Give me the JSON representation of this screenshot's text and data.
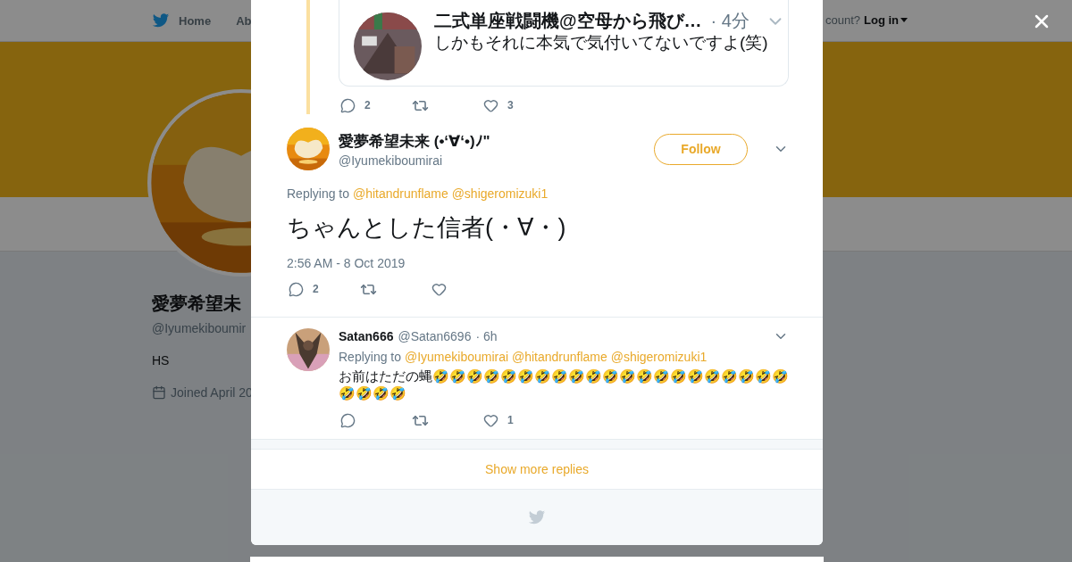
{
  "nav": {
    "home": "Home",
    "about": "Ab",
    "account_prompt": "count?",
    "login": "Log in"
  },
  "profile": {
    "name": "愛夢希望未",
    "handle": "@Iyumekiboumir",
    "bio": "HS",
    "joined": "Joined April 20"
  },
  "quoted_tweet": {
    "name": "二式単座戦闘機@空母から飛び…",
    "time": "· 4分",
    "text": "しかもそれに本気で気付いてないですよ(笑)",
    "replies": "2",
    "likes": "3"
  },
  "tweet": {
    "name": "愛夢希望未来 (•‘∀‘•)ﾉ\"",
    "handle": "@Iyumekiboumirai",
    "follow": "Follow",
    "replying_label": "Replying to",
    "mentions": [
      "@hitandrunflame",
      "@shigeromizuki1"
    ],
    "text": "ちゃんとした信者(・∀・)",
    "timestamp": "2:56 AM - 8 Oct 2019",
    "replies": "2"
  },
  "replies": [
    {
      "name": "Satan666",
      "handle": "@Satan6696",
      "time": "· 6h",
      "replying_label": "Replying to",
      "mentions": [
        "@Iyumekiboumirai",
        "@hitandrunflame",
        "@shigeromizuki1"
      ],
      "text": "お前はただの蝿🤣🤣🤣🤣🤣🤣🤣🤣🤣🤣🤣🤣🤣🤣🤣🤣🤣🤣🤣🤣🤣🤣🤣🤣🤣",
      "likes": "1"
    }
  ],
  "show_more": "Show more replies"
}
